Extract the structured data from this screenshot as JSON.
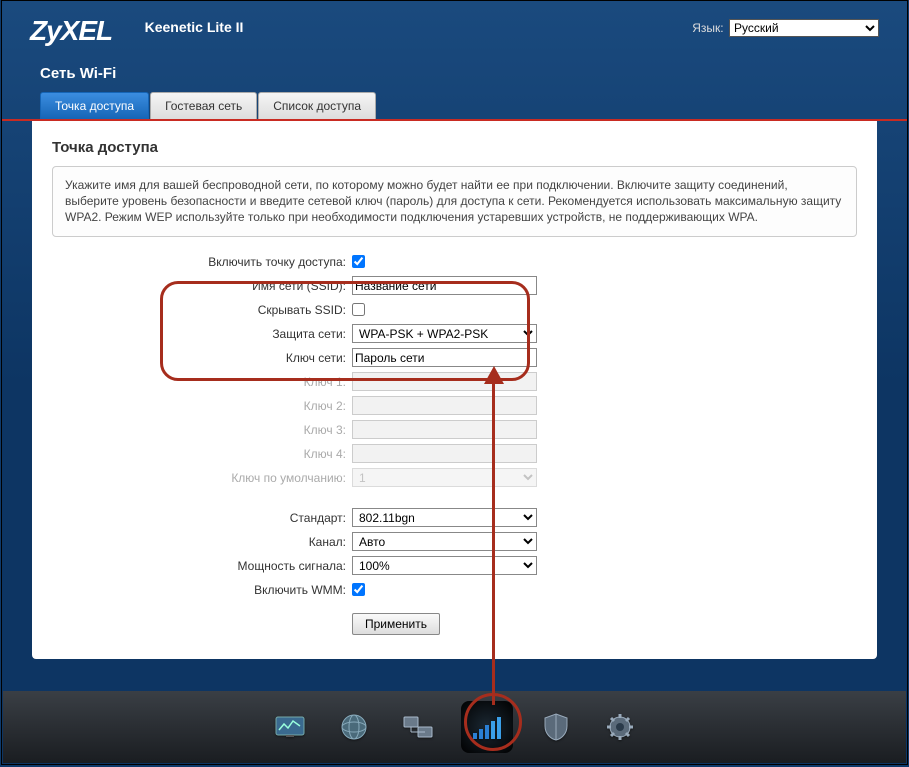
{
  "brand": "ZyXEL",
  "model": "Keenetic Lite II",
  "lang_label": "Язык:",
  "lang_value": "Русский",
  "page_title": "Сеть Wi-Fi",
  "tabs": {
    "t0": "Точка доступа",
    "t1": "Гостевая сеть",
    "t2": "Список доступа"
  },
  "panel_heading": "Точка доступа",
  "infobox": "Укажите имя для вашей беспроводной сети, по которому можно будет найти ее при подключении. Включите защиту соединений, выберите уровень безопасности и введите сетевой ключ (пароль) для доступа к сети. Рекомендуется использовать максимальную защиту WPA2. Режим WEP используйте только при необходимости подключения устаревших устройств, не поддерживающих WPA.",
  "form": {
    "enable_ap": "Включить точку доступа:",
    "ssid_label": "Имя сети (SSID):",
    "ssid_value": "Название сети",
    "hide_ssid": "Скрывать SSID:",
    "security_label": "Защита сети:",
    "security_value": "WPA-PSK + WPA2-PSK",
    "key_label": "Ключ сети:",
    "key_value": "Пароль сети",
    "key1": "Ключ 1:",
    "key2": "Ключ 2:",
    "key3": "Ключ 3:",
    "key4": "Ключ 4:",
    "key_default": "Ключ по умолчанию:",
    "key_default_value": "1",
    "standard_label": "Стандарт:",
    "standard_value": "802.11bgn",
    "channel_label": "Канал:",
    "channel_value": "Авто",
    "power_label": "Мощность сигнала:",
    "power_value": "100%",
    "wmm_label": "Включить WMM:",
    "apply": "Применить"
  }
}
